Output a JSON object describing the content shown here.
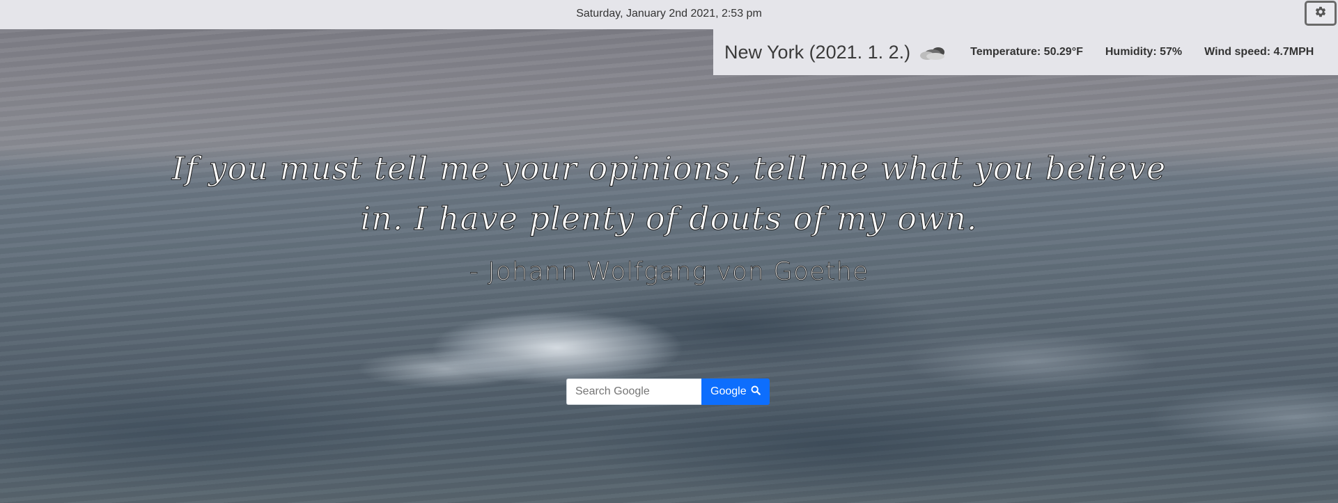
{
  "header": {
    "datetime": "Saturday, January 2nd 2021, 2:53 pm",
    "settings_icon": "gear-icon"
  },
  "weather": {
    "city_date": "New York (2021. 1. 2.)",
    "icon": "cloud-icon",
    "temperature": "Temperature: 50.29°F",
    "humidity": "Humidity: 57%",
    "wind_speed": "Wind speed: 4.7MPH"
  },
  "quote": {
    "line1": "If you must tell me your opinions, tell me what you believe",
    "line2": "in. I have plenty of douts of my own.",
    "author": "- Johann Wolfgang von Goethe"
  },
  "search": {
    "placeholder": "Search Google",
    "button_label": "Google",
    "button_icon": "search-icon"
  },
  "colors": {
    "bar_bg": "#e5e5ea",
    "button_blue": "#0d6efd"
  }
}
